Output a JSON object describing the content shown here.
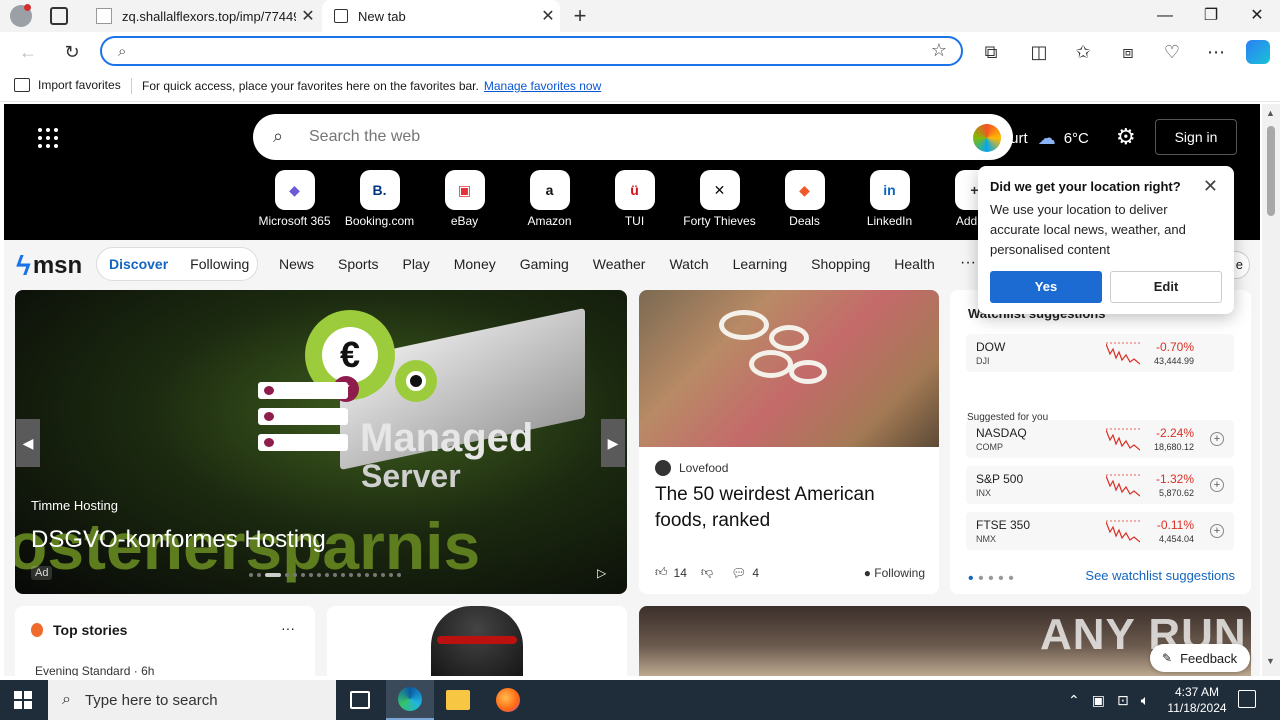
{
  "tabs": [
    {
      "title": "zq.shallalflexors.top/imp/77449"
    },
    {
      "title": "New tab"
    }
  ],
  "address_bar": {
    "value": "",
    "placeholder": ""
  },
  "favorites_bar": {
    "import_label": "Import favorites",
    "message": "For quick access, place your favorites here on the favorites bar.",
    "manage_link": "Manage favorites now"
  },
  "msn_header": {
    "search_placeholder": "Search the web",
    "location": "furt",
    "temperature": "6°C",
    "signin": "Sign in"
  },
  "quick_links": [
    {
      "label": "Microsoft 365",
      "icon": "microsoft365-icon",
      "glyph": "◆",
      "color": "#6b5bd6"
    },
    {
      "label": "Booking.com",
      "icon": "booking-icon",
      "glyph": "B.",
      "color": "#003580"
    },
    {
      "label": "eBay",
      "icon": "ebay-bag-icon",
      "glyph": "▣",
      "color": "#e53238"
    },
    {
      "label": "Amazon",
      "icon": "amazon-icon",
      "glyph": "a",
      "color": "#111111"
    },
    {
      "label": "TUI",
      "icon": "tui-icon",
      "glyph": "ü",
      "color": "#d40e14"
    },
    {
      "label": "Forty Thieves",
      "icon": "forty-thieves-icon",
      "glyph": "✕",
      "color": "#111111"
    },
    {
      "label": "Deals",
      "icon": "deals-icon",
      "glyph": "◆",
      "color": "#f05a28"
    },
    {
      "label": "LinkedIn",
      "icon": "linkedin-icon",
      "glyph": "in",
      "color": "#0a66c2"
    },
    {
      "label": "Add sh",
      "icon": "plus-icon",
      "glyph": "+",
      "color": "#333333"
    }
  ],
  "nav": {
    "logo": "msn",
    "discover": "Discover",
    "following": "Following",
    "categories": [
      "News",
      "Sports",
      "Play",
      "Money",
      "Gaming",
      "Weather",
      "Watch",
      "Learning",
      "Shopping",
      "Health"
    ],
    "more": "···",
    "right_fragment": "e"
  },
  "carousel": {
    "managed": "Managed",
    "server": "Server",
    "big_text": "ostenersparnis",
    "source": "Timme Hosting",
    "headline": "DSGVO-konformes Hosting",
    "ad": "Ad",
    "dot_count": 18,
    "active_dot": 2
  },
  "article": {
    "source": "Lovefood",
    "title": "The 50 weirdest American foods, ranked",
    "likes": "14",
    "comments": "4",
    "following": "Following"
  },
  "watchlist": {
    "title": "Watchlist suggestions",
    "suggested_label": "Suggested for you",
    "see_all": "See watchlist suggestions",
    "items": [
      {
        "name": "DOW",
        "ticker": "DJI",
        "change": "-0.70%",
        "value": "43,444.99",
        "addable": false
      },
      {
        "name": "NASDAQ",
        "ticker": "COMP",
        "change": "-2.24%",
        "value": "18,680.12",
        "addable": true
      },
      {
        "name": "S&P 500",
        "ticker": "INX",
        "change": "-1.32%",
        "value": "5,870.62",
        "addable": true
      },
      {
        "name": "FTSE 350",
        "ticker": "NMX",
        "change": "-0.11%",
        "value": "4,454.04",
        "addable": true
      }
    ]
  },
  "location_popup": {
    "title": "Did we get your location right?",
    "body": "We use your location to deliver accurate local news, weather, and personalised content",
    "yes": "Yes",
    "edit": "Edit"
  },
  "top_stories": {
    "title": "Top stories",
    "source": "Evening Standard · 6h"
  },
  "feedback": "Feedback",
  "watermark": "ANY RUN",
  "taskbar": {
    "search_placeholder": "Type here to search",
    "time": "4:37 AM",
    "date": "11/18/2024"
  }
}
